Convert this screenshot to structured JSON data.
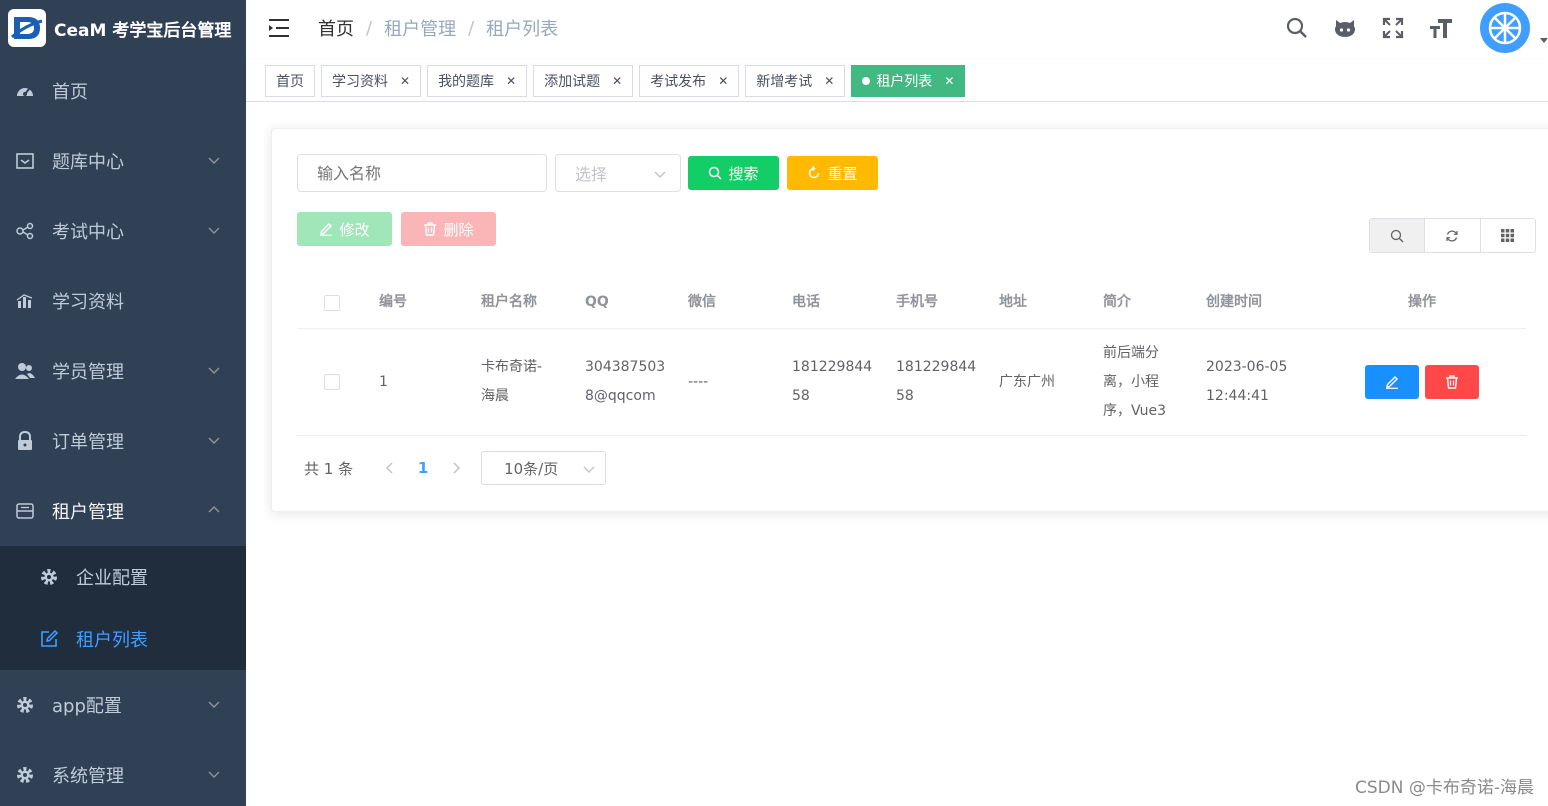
{
  "app": {
    "title": "CeaM 考学宝后台管理"
  },
  "sidebar": {
    "items": [
      {
        "label": "首页",
        "icon": "dashboard-icon"
      },
      {
        "label": "题库中心",
        "icon": "inbox-icon"
      },
      {
        "label": "考试中心",
        "icon": "share-icon"
      },
      {
        "label": "学习资料",
        "icon": "chart-icon"
      },
      {
        "label": "学员管理",
        "icon": "users-icon"
      },
      {
        "label": "订单管理",
        "icon": "lock-icon"
      },
      {
        "label": "租户管理",
        "icon": "storage-icon"
      }
    ],
    "sub": [
      {
        "label": "企业配置",
        "icon": "gear-icon"
      },
      {
        "label": "租户列表",
        "icon": "edit-icon"
      }
    ],
    "after": [
      {
        "label": "app配置",
        "icon": "gear-icon"
      },
      {
        "label": "系统管理",
        "icon": "gear-icon"
      }
    ]
  },
  "header": {
    "breadcrumb": [
      "首页",
      "租户管理",
      "租户列表"
    ]
  },
  "tags": [
    {
      "label": "首页"
    },
    {
      "label": "学习资料"
    },
    {
      "label": "我的题库"
    },
    {
      "label": "添加试题"
    },
    {
      "label": "考试发布"
    },
    {
      "label": "新增考试"
    },
    {
      "label": "租户列表"
    }
  ],
  "filters": {
    "name_placeholder": "输入名称",
    "select_placeholder": "选择",
    "search_label": "搜索",
    "reset_label": "重置",
    "edit_label": "修改",
    "delete_label": "删除"
  },
  "table": {
    "columns": [
      "编号",
      "租户名称",
      "QQ",
      "微信",
      "电话",
      "手机号",
      "地址",
      "简介",
      "创建时间",
      "操作"
    ],
    "rows": [
      {
        "id": "1",
        "name": [
          "卡布奇诺-",
          "海晨"
        ],
        "qq": [
          "304387503",
          "8@qqcom"
        ],
        "wechat": "----",
        "tel": [
          "181229844",
          "58"
        ],
        "mobile": [
          "181229844",
          "58"
        ],
        "address": "广东广州",
        "intro": [
          "前后端分",
          "离，小程",
          "序，Vue3"
        ],
        "created": [
          "2023-06-05",
          "12:44:41"
        ]
      }
    ]
  },
  "pagination": {
    "total": "共 1 条",
    "current": "1",
    "page_size": "10条/页"
  },
  "watermark": "CSDN @卡布奇诺-海晨",
  "colors": {
    "sidebar": "#304156",
    "active": "#409eff",
    "tag_active": "#42b983",
    "success": "#13ce66",
    "warning": "#ffba00",
    "danger": "#ff4949",
    "primary": "#1890ff"
  }
}
